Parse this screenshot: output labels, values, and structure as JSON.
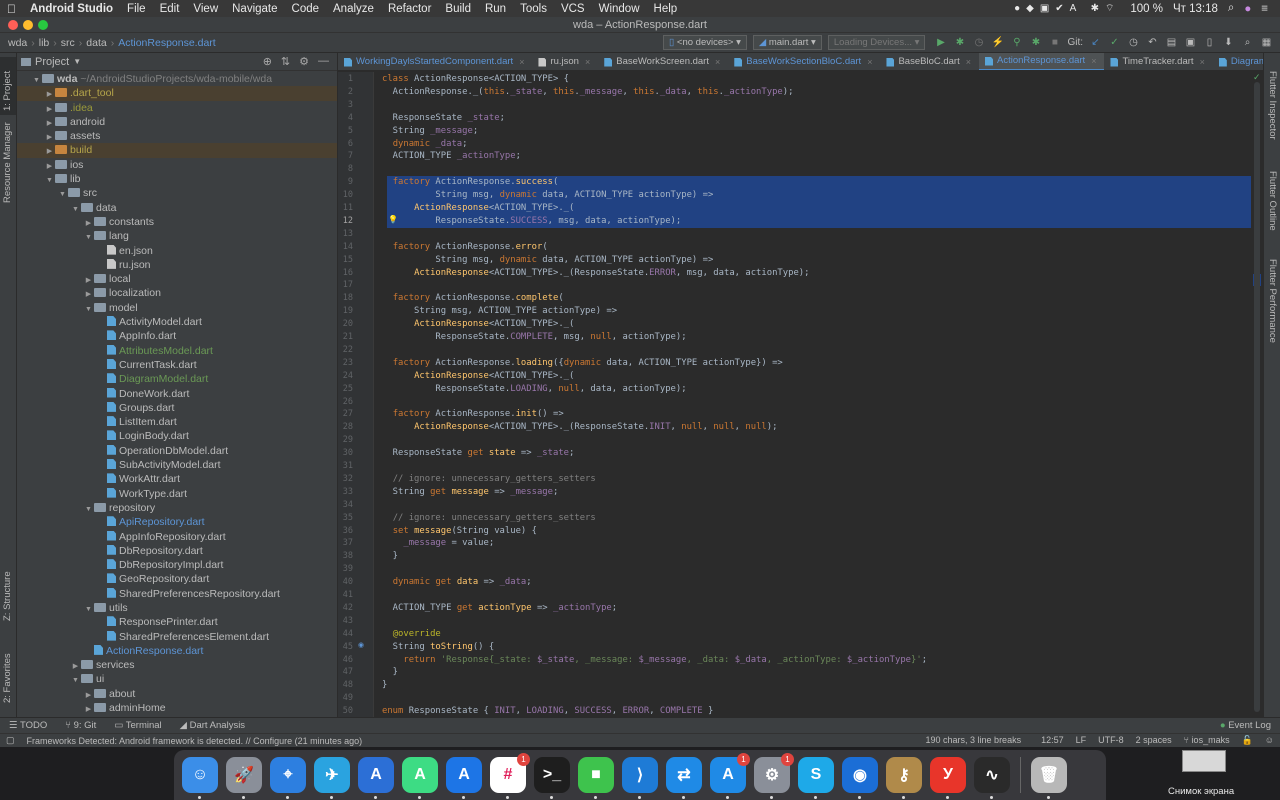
{
  "menubar": {
    "app": "Android Studio",
    "items": [
      "File",
      "Edit",
      "View",
      "Navigate",
      "Code",
      "Analyze",
      "Refactor",
      "Build",
      "Run",
      "Tools",
      "VCS",
      "Window",
      "Help"
    ],
    "battery": "100 %",
    "clock": "Чт 13:18"
  },
  "window": {
    "title": "wda – ActionResponse.dart"
  },
  "navbar": {
    "breadcrumbs": [
      "wda",
      "lib",
      "src",
      "data",
      "ActionResponse.dart"
    ],
    "device": "<no devices>",
    "run_config": "main.dart",
    "loading": "Loading Devices...",
    "git_label": "Git:"
  },
  "left_stripe": {
    "project": "1: Project",
    "resource": "Resource Manager",
    "structure": "Z: Structure",
    "favorites": "2: Favorites"
  },
  "right_stripe": {
    "inspector": "Flutter Inspector",
    "outline": "Flutter Outline",
    "performance": "Flutter Performance"
  },
  "project_panel": {
    "title": "Project",
    "tree": [
      {
        "depth": 0,
        "arrow": "▼",
        "type": "folder",
        "label": "wda",
        "hint": " ~/AndroidStudioProjects/wda-mobile/wda",
        "style": "bold"
      },
      {
        "depth": 1,
        "arrow": "▶",
        "type": "folder-orange",
        "label": ".dart_tool",
        "style": "yellow",
        "hl": "excluded"
      },
      {
        "depth": 1,
        "arrow": "▶",
        "type": "folder",
        "label": ".idea",
        "style": "olive"
      },
      {
        "depth": 1,
        "arrow": "▶",
        "type": "folder",
        "label": "android",
        "style": ""
      },
      {
        "depth": 1,
        "arrow": "▶",
        "type": "folder",
        "label": "assets",
        "style": ""
      },
      {
        "depth": 1,
        "arrow": "▶",
        "type": "folder-orange",
        "label": "build",
        "style": "yellow",
        "hl": "excluded"
      },
      {
        "depth": 1,
        "arrow": "▶",
        "type": "folder",
        "label": "ios",
        "style": ""
      },
      {
        "depth": 1,
        "arrow": "▼",
        "type": "folder",
        "label": "lib",
        "style": ""
      },
      {
        "depth": 2,
        "arrow": "▼",
        "type": "folder",
        "label": "src",
        "style": ""
      },
      {
        "depth": 3,
        "arrow": "▼",
        "type": "folder",
        "label": "data",
        "style": ""
      },
      {
        "depth": 4,
        "arrow": "▶",
        "type": "folder",
        "label": "constants",
        "style": ""
      },
      {
        "depth": 4,
        "arrow": "▼",
        "type": "folder",
        "label": "lang",
        "style": ""
      },
      {
        "depth": 5,
        "arrow": "",
        "type": "json",
        "label": "en.json",
        "style": ""
      },
      {
        "depth": 5,
        "arrow": "",
        "type": "json",
        "label": "ru.json",
        "style": ""
      },
      {
        "depth": 4,
        "arrow": "▶",
        "type": "folder",
        "label": "local",
        "style": ""
      },
      {
        "depth": 4,
        "arrow": "▶",
        "type": "folder",
        "label": "localization",
        "style": ""
      },
      {
        "depth": 4,
        "arrow": "▼",
        "type": "folder",
        "label": "model",
        "style": ""
      },
      {
        "depth": 5,
        "arrow": "",
        "type": "dart",
        "label": "ActivityModel.dart",
        "style": ""
      },
      {
        "depth": 5,
        "arrow": "",
        "type": "dart",
        "label": "AppInfo.dart",
        "style": ""
      },
      {
        "depth": 5,
        "arrow": "",
        "type": "dart",
        "label": "AttributesModel.dart",
        "style": "green"
      },
      {
        "depth": 5,
        "arrow": "",
        "type": "dart",
        "label": "CurrentTask.dart",
        "style": ""
      },
      {
        "depth": 5,
        "arrow": "",
        "type": "dart",
        "label": "DiagramModel.dart",
        "style": "green"
      },
      {
        "depth": 5,
        "arrow": "",
        "type": "dart",
        "label": "DoneWork.dart",
        "style": ""
      },
      {
        "depth": 5,
        "arrow": "",
        "type": "dart",
        "label": "Groups.dart",
        "style": ""
      },
      {
        "depth": 5,
        "arrow": "",
        "type": "dart",
        "label": "ListItem.dart",
        "style": ""
      },
      {
        "depth": 5,
        "arrow": "",
        "type": "dart",
        "label": "LoginBody.dart",
        "style": ""
      },
      {
        "depth": 5,
        "arrow": "",
        "type": "dart",
        "label": "OperationDbModel.dart",
        "style": ""
      },
      {
        "depth": 5,
        "arrow": "",
        "type": "dart",
        "label": "SubActivityModel.dart",
        "style": ""
      },
      {
        "depth": 5,
        "arrow": "",
        "type": "dart",
        "label": "WorkAttr.dart",
        "style": ""
      },
      {
        "depth": 5,
        "arrow": "",
        "type": "dart",
        "label": "WorkType.dart",
        "style": ""
      },
      {
        "depth": 4,
        "arrow": "▼",
        "type": "folder",
        "label": "repository",
        "style": ""
      },
      {
        "depth": 5,
        "arrow": "",
        "type": "dart",
        "label": "ApiRepository.dart",
        "style": "blue"
      },
      {
        "depth": 5,
        "arrow": "",
        "type": "dart",
        "label": "AppInfoRepository.dart",
        "style": ""
      },
      {
        "depth": 5,
        "arrow": "",
        "type": "dart",
        "label": "DbRepository.dart",
        "style": ""
      },
      {
        "depth": 5,
        "arrow": "",
        "type": "dart",
        "label": "DbRepositoryImpl.dart",
        "style": ""
      },
      {
        "depth": 5,
        "arrow": "",
        "type": "dart",
        "label": "GeoRepository.dart",
        "style": ""
      },
      {
        "depth": 5,
        "arrow": "",
        "type": "dart",
        "label": "SharedPreferencesRepository.dart",
        "style": ""
      },
      {
        "depth": 4,
        "arrow": "▼",
        "type": "folder",
        "label": "utils",
        "style": ""
      },
      {
        "depth": 5,
        "arrow": "",
        "type": "dart",
        "label": "ResponsePrinter.dart",
        "style": ""
      },
      {
        "depth": 5,
        "arrow": "",
        "type": "dart",
        "label": "SharedPreferencesElement.dart",
        "style": ""
      },
      {
        "depth": 4,
        "arrow": "",
        "type": "dart",
        "label": "ActionResponse.dart",
        "style": "blue"
      },
      {
        "depth": 3,
        "arrow": "▶",
        "type": "folder",
        "label": "services",
        "style": ""
      },
      {
        "depth": 3,
        "arrow": "▼",
        "type": "folder",
        "label": "ui",
        "style": ""
      },
      {
        "depth": 4,
        "arrow": "▶",
        "type": "folder",
        "label": "about",
        "style": ""
      },
      {
        "depth": 4,
        "arrow": "▶",
        "type": "folder",
        "label": "adminHome",
        "style": ""
      }
    ]
  },
  "tabs": [
    {
      "label": "WorkingDaylsStartedComponent.dart",
      "state": "modified"
    },
    {
      "label": "ru.json",
      "state": ""
    },
    {
      "label": "BaseWorkScreen.dart",
      "state": ""
    },
    {
      "label": "BaseWorkSectionBloC.dart",
      "state": "modified"
    },
    {
      "label": "BaseBloC.dart",
      "state": ""
    },
    {
      "label": "ActionResponse.dart",
      "state": "active"
    },
    {
      "label": "TimeTracker.dart",
      "state": ""
    },
    {
      "label": "DiagramPage",
      "state": "modified"
    }
  ],
  "code_lines": [
    "<span class=\"kw\">class</span> ActionResponse&lt;ACTION_TYPE&gt; {",
    "  ActionResponse._(<span class=\"kw\">this</span>.<span class=\"cn\">_state</span>, <span class=\"kw\">this</span>.<span class=\"cn\">_message</span>, <span class=\"kw\">this</span>.<span class=\"cn\">_data</span>, <span class=\"kw\">this</span>.<span class=\"cn\">_actionType</span>);",
    "",
    "  ResponseState <span class=\"cn\">_state</span>;",
    "  String <span class=\"cn\">_message</span>;",
    "  <span class=\"kw\">dynamic</span> <span class=\"cn\">_data</span>;",
    "  ACTION_TYPE <span class=\"cn\">_actionType</span>;",
    "",
    "  <span class=\"kw\">factory</span> ActionResponse.<span class=\"fn\">success</span>(",
    "          String msg, <span class=\"kw\">dynamic</span> data, ACTION_TYPE actionType) =&gt;",
    "      <span class=\"cls\">ActionResponse</span>&lt;ACTION_TYPE&gt;._(",
    "          ResponseState.<span class=\"cn\">SUCCESS</span>, msg, data, actionType);",
    "",
    "  <span class=\"kw\">factory</span> ActionResponse.<span class=\"fn\">error</span>(",
    "          String msg, <span class=\"kw\">dynamic</span> data, ACTION_TYPE actionType) =&gt;",
    "      <span class=\"cls\">ActionResponse</span>&lt;ACTION_TYPE&gt;._(ResponseState.<span class=\"cn\">ERROR</span>, msg, data, actionType);",
    "",
    "  <span class=\"kw\">factory</span> ActionResponse.<span class=\"fn\">complete</span>(",
    "      String msg, ACTION_TYPE actionType) =&gt;",
    "      <span class=\"cls\">ActionResponse</span>&lt;ACTION_TYPE&gt;._(",
    "          ResponseState.<span class=\"cn\">COMPLETE</span>, msg, <span class=\"kw\">null</span>, actionType);",
    "",
    "  <span class=\"kw\">factory</span> ActionResponse.<span class=\"fn\">loading</span>({<span class=\"kw\">dynamic</span> data, ACTION_TYPE actionType}) =&gt;",
    "      <span class=\"cls\">ActionResponse</span>&lt;ACTION_TYPE&gt;._(",
    "          ResponseState.<span class=\"cn\">LOADING</span>, <span class=\"kw\">null</span>, data, actionType);",
    "",
    "  <span class=\"kw\">factory</span> ActionResponse.<span class=\"fn\">init</span>() =&gt;",
    "      <span class=\"cls\">ActionResponse</span>&lt;ACTION_TYPE&gt;._(ResponseState.<span class=\"cn\">INIT</span>, <span class=\"kw\">null</span>, <span class=\"kw\">null</span>, <span class=\"kw\">null</span>);",
    "",
    "  ResponseState <span class=\"kw\">get</span> <span class=\"fn\">state</span> =&gt; <span class=\"cn\">_state</span>;",
    "",
    "  <span class=\"cmt\">// ignore: unnecessary_getters_setters</span>",
    "  String <span class=\"kw\">get</span> <span class=\"fn\">message</span> =&gt; <span class=\"cn\">_message</span>;",
    "",
    "  <span class=\"cmt\">// ignore: unnecessary_getters_setters</span>",
    "  <span class=\"kw\">set</span> <span class=\"fn\">message</span>(String value) {",
    "    <span class=\"cn\">_message</span> = value;",
    "  }",
    "",
    "  <span class=\"kw\">dynamic</span> <span class=\"kw\">get</span> <span class=\"fn\">data</span> =&gt; <span class=\"cn\">_data</span>;",
    "",
    "  ACTION_TYPE <span class=\"kw\">get</span> <span class=\"fn\">actionType</span> =&gt; <span class=\"cn\">_actionType</span>;",
    "",
    "  <span class=\"ann\">@override</span>",
    "  String <span class=\"fn\">toString</span>() {",
    "    <span class=\"kw\">return</span> <span class=\"str\">'Response{_state: </span><span class=\"cn\">$_state</span><span class=\"str\">, _message: </span><span class=\"cn\">$_message</span><span class=\"str\">, _data: </span><span class=\"cn\">$_data</span><span class=\"str\">, _actionType: </span><span class=\"cn\">$_actionType</span><span class=\"str\">}'</span>;",
    "  }",
    "}",
    "",
    "<span class=\"kw\">enum</span> ResponseState { <span class=\"cn\">INIT</span>, <span class=\"cn\">LOADING</span>, <span class=\"cn\">SUCCESS</span>, <span class=\"cn\">ERROR</span>, <span class=\"cn\">COMPLETE</span> }"
  ],
  "selected_lines": [
    9,
    10,
    11,
    12
  ],
  "bottom_tools": [
    "TODO",
    "9: Git",
    "Terminal",
    "Dart Analysis"
  ],
  "event_log": "Event Log",
  "status": {
    "message": "Frameworks Detected: Android framework is detected. // Configure (21 minutes ago)",
    "selection": "190 chars, 3 line breaks",
    "position": "12:57",
    "line_sep": "LF",
    "encoding": "UTF-8",
    "indent": "2 spaces",
    "branch": "ios_maks"
  },
  "dock": {
    "apps": [
      {
        "name": "finder",
        "glyph": "☺",
        "color": "#3b8ee8",
        "badge": ""
      },
      {
        "name": "launchpad",
        "glyph": "🚀",
        "color": "#8a8f99",
        "badge": ""
      },
      {
        "name": "safari",
        "glyph": "⌖",
        "color": "#2d7fe0",
        "badge": ""
      },
      {
        "name": "telegram",
        "glyph": "✈",
        "color": "#2aa3e0",
        "badge": ""
      },
      {
        "name": "xcode-instruments",
        "glyph": "A",
        "color": "#2c6fd6",
        "badge": ""
      },
      {
        "name": "android-studio",
        "glyph": "A",
        "color": "#3ddc84",
        "badge": ""
      },
      {
        "name": "xcode",
        "glyph": "A",
        "color": "#1d75e6",
        "badge": ""
      },
      {
        "name": "slack",
        "glyph": "#",
        "color": "#ffffff",
        "badge": "1"
      },
      {
        "name": "terminal",
        "glyph": ">_",
        "color": "#1e1e1e",
        "badge": ""
      },
      {
        "name": "facetime",
        "glyph": "■",
        "color": "#3ec34d",
        "badge": ""
      },
      {
        "name": "vscode",
        "glyph": "⟩",
        "color": "#1e7bd6",
        "badge": ""
      },
      {
        "name": "teamviewer",
        "glyph": "⇄",
        "color": "#1f8ae6",
        "badge": ""
      },
      {
        "name": "app-store",
        "glyph": "A",
        "color": "#1f8ae6",
        "badge": "1"
      },
      {
        "name": "system-preferences",
        "glyph": "⚙",
        "color": "#8a8f99",
        "badge": "1"
      },
      {
        "name": "skype",
        "glyph": "S",
        "color": "#1ea9e8",
        "badge": ""
      },
      {
        "name": "maps-pin",
        "glyph": "◉",
        "color": "#1b6ed6",
        "badge": ""
      },
      {
        "name": "keychain",
        "glyph": "⚷",
        "color": "#b08a4a",
        "badge": ""
      },
      {
        "name": "yandex",
        "glyph": "У",
        "color": "#e8352a",
        "badge": ""
      },
      {
        "name": "activity-monitor",
        "glyph": "∿",
        "color": "#2a2a2a",
        "badge": ""
      },
      {
        "name": "trash",
        "glyph": "🗑",
        "color": "#b8b8b8",
        "badge": ""
      }
    ],
    "screenshot_label": "Снимок экрана"
  }
}
